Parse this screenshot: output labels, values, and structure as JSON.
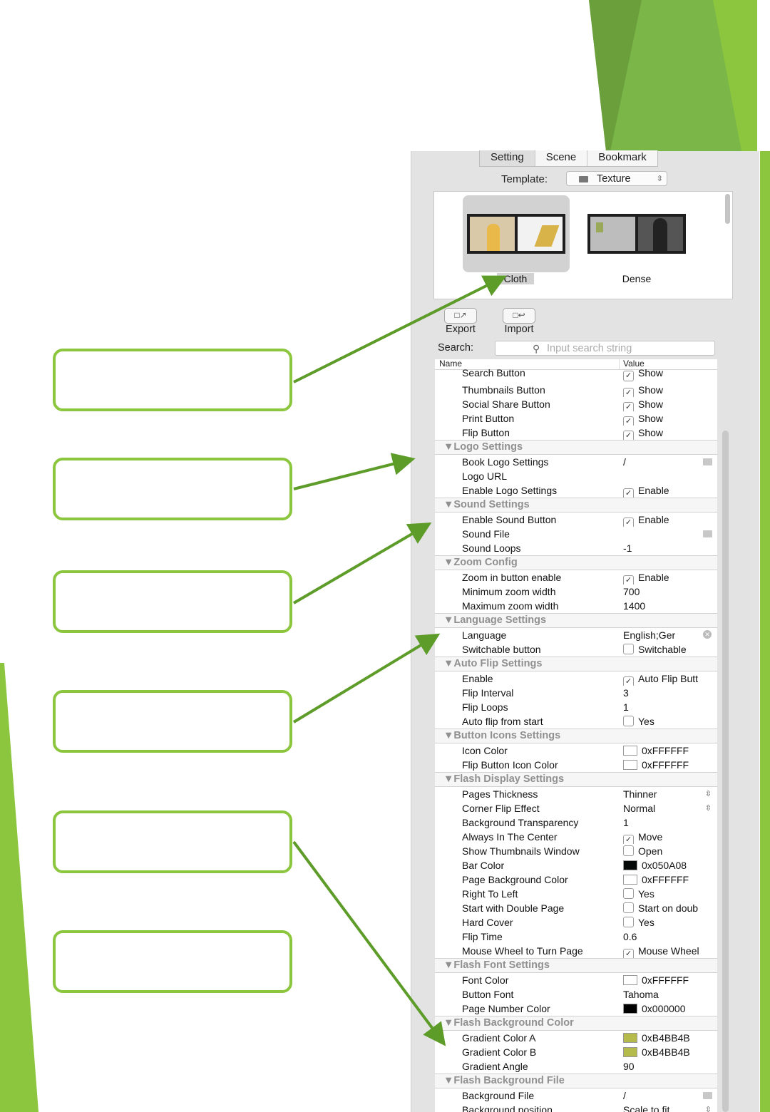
{
  "colors": {
    "accent": "#8cc63f",
    "accent_dark": "#5e9c2a",
    "panel_bg": "#e3e3e3"
  },
  "tabs": [
    "Setting",
    "Scene",
    "Bookmark"
  ],
  "template": {
    "label": "Template:",
    "value": "Texture"
  },
  "gallery": {
    "items": [
      "Cloth",
      "Dense"
    ]
  },
  "toolbar": {
    "export_label": "Export",
    "import_label": "Import"
  },
  "search": {
    "label": "Search:",
    "placeholder": "Input search string"
  },
  "table": {
    "headers": {
      "name": "Name",
      "value": "Value"
    },
    "rows": [
      {
        "name": "Search Button",
        "value": "Show",
        "kind": "check",
        "checked": true,
        "top": true
      },
      {
        "name": "Thumbnails Button",
        "value": "Show",
        "kind": "check",
        "checked": true
      },
      {
        "name": "Social Share Button",
        "value": "Show",
        "kind": "check",
        "checked": true
      },
      {
        "name": "Print Button",
        "value": "Show",
        "kind": "check",
        "checked": true
      },
      {
        "name": "Flip Button",
        "value": "Show",
        "kind": "check",
        "checked": true
      },
      {
        "group": "Logo Settings"
      },
      {
        "name": "Book Logo Settings",
        "value": "/",
        "kind": "file"
      },
      {
        "name": "Logo URL",
        "value": ""
      },
      {
        "name": "Enable Logo Settings",
        "value": "Enable",
        "kind": "check",
        "checked": true
      },
      {
        "group": "Sound Settings"
      },
      {
        "name": "Enable Sound Button",
        "value": "Enable",
        "kind": "check",
        "checked": true
      },
      {
        "name": "Sound File",
        "value": "",
        "kind": "file"
      },
      {
        "name": "Sound Loops",
        "value": "-1"
      },
      {
        "group": "Zoom Config"
      },
      {
        "name": "Zoom in button enable",
        "value": "Enable",
        "kind": "check",
        "checked": true
      },
      {
        "name": "Minimum zoom width",
        "value": "700"
      },
      {
        "name": "Maximum zoom width",
        "value": "1400"
      },
      {
        "group": "Language Settings"
      },
      {
        "name": "Language",
        "value": "English;Ger",
        "kind": "clear"
      },
      {
        "name": "Switchable button",
        "value": "Switchable",
        "kind": "check",
        "checked": false
      },
      {
        "group": "Auto Flip Settings"
      },
      {
        "name": "Enable",
        "value": "Auto Flip Butt",
        "kind": "check",
        "checked": true
      },
      {
        "name": "Flip Interval",
        "value": "3"
      },
      {
        "name": "Flip Loops",
        "value": "1"
      },
      {
        "name": "Auto flip from start",
        "value": "Yes",
        "kind": "check",
        "checked": false
      },
      {
        "group": "Button Icons Settings"
      },
      {
        "name": "Icon Color",
        "value": "0xFFFFFF",
        "kind": "color",
        "color": "#FFFFFF"
      },
      {
        "name": "Flip Button Icon Color",
        "value": "0xFFFFFF",
        "kind": "color",
        "color": "#FFFFFF"
      },
      {
        "group": "Flash Display Settings"
      },
      {
        "name": "Pages Thickness",
        "value": "Thinner",
        "kind": "select"
      },
      {
        "name": "Corner Flip Effect",
        "value": "Normal",
        "kind": "select"
      },
      {
        "name": "Background Transparency",
        "value": "1"
      },
      {
        "name": "Always In The Center",
        "value": "Move",
        "kind": "check",
        "checked": true
      },
      {
        "name": "Show Thumbnails Window",
        "value": "Open",
        "kind": "check",
        "checked": false
      },
      {
        "name": "Bar Color",
        "value": "0x050A08",
        "kind": "color",
        "color": "#050A08"
      },
      {
        "name": "Page Background Color",
        "value": "0xFFFFFF",
        "kind": "color",
        "color": "#FFFFFF"
      },
      {
        "name": "Right To Left",
        "value": "Yes",
        "kind": "check",
        "checked": false
      },
      {
        "name": "Start with Double Page",
        "value": "Start on doub",
        "kind": "check",
        "checked": false
      },
      {
        "name": "Hard Cover",
        "value": "Yes",
        "kind": "check",
        "checked": false
      },
      {
        "name": "Flip Time",
        "value": "0.6"
      },
      {
        "name": "Mouse Wheel to Turn Page",
        "value": "Mouse Wheel",
        "kind": "check",
        "checked": true
      },
      {
        "group": "Flash Font Settings"
      },
      {
        "name": "Font Color",
        "value": "0xFFFFFF",
        "kind": "color",
        "color": "#FFFFFF"
      },
      {
        "name": "Button Font",
        "value": "Tahoma"
      },
      {
        "name": "Page Number Color",
        "value": "0x000000",
        "kind": "color",
        "color": "#000000"
      },
      {
        "group": "Flash Background Color"
      },
      {
        "name": "Gradient Color A",
        "value": "0xB4BB4B",
        "kind": "color",
        "color": "#B4BB4B"
      },
      {
        "name": "Gradient Color B",
        "value": "0xB4BB4B",
        "kind": "color",
        "color": "#B4BB4B"
      },
      {
        "name": "Gradient Angle",
        "value": "90"
      },
      {
        "group": "Flash Background File"
      },
      {
        "name": "Background File",
        "value": "/",
        "kind": "file"
      },
      {
        "name": "Background position",
        "value": "Scale to fit",
        "kind": "select"
      }
    ]
  }
}
